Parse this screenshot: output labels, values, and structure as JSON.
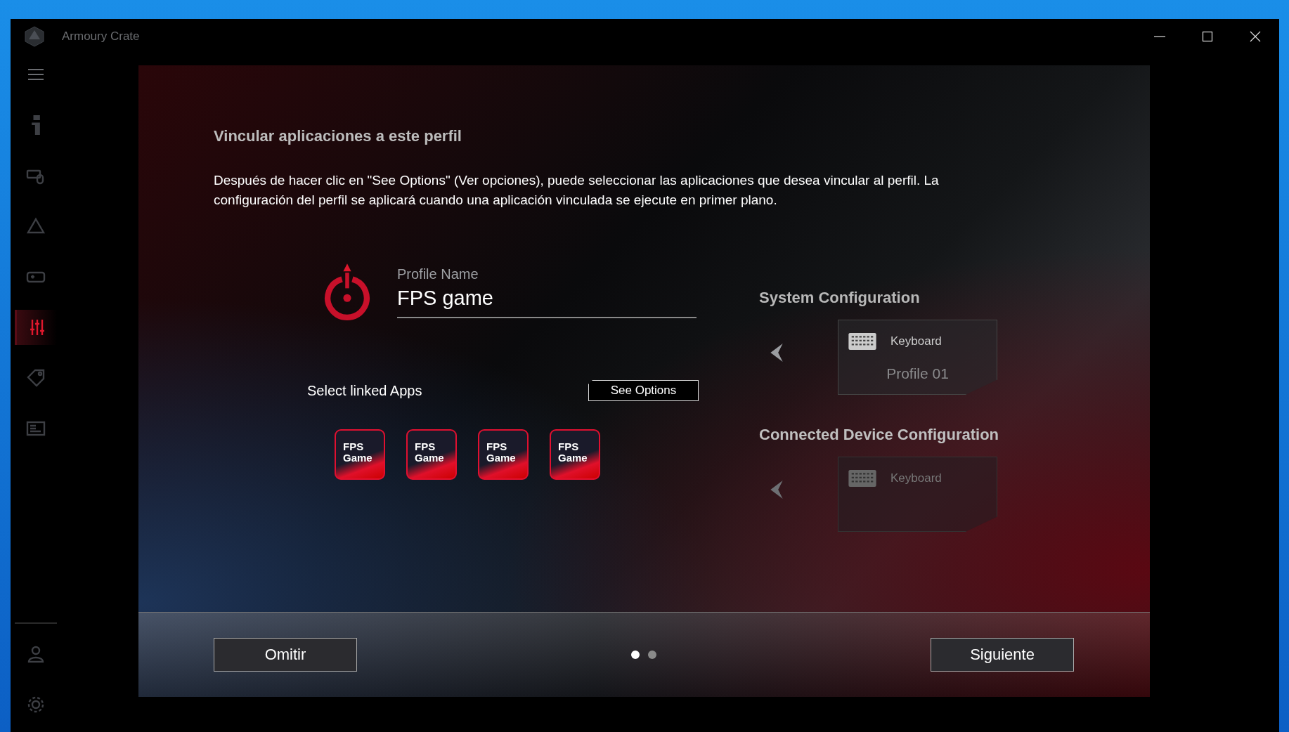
{
  "window": {
    "title": "Armoury Crate"
  },
  "sidebar": {
    "items": [
      {
        "kind": "menu",
        "selected": false
      },
      {
        "kind": "info",
        "selected": false
      },
      {
        "kind": "devices",
        "selected": false
      },
      {
        "kind": "aura",
        "selected": false
      },
      {
        "kind": "gamepad",
        "selected": false
      },
      {
        "kind": "sliders",
        "selected": true
      },
      {
        "kind": "tag",
        "selected": false
      },
      {
        "kind": "news",
        "selected": false
      }
    ],
    "bottom_items": [
      {
        "kind": "user",
        "selected": false
      },
      {
        "kind": "settings",
        "selected": false
      }
    ]
  },
  "dialog": {
    "title": "Vincular aplicaciones a este perfil",
    "description": "Después de hacer clic en \"See Options\" (Ver opciones), puede seleccionar las aplicaciones que desea vincular al perfil. La configuración del perfil se aplicará cuando una aplicación vinculada se ejecute en primer plano.",
    "profile_name": {
      "label": "Profile Name",
      "value": "FPS game"
    },
    "linked_apps": {
      "label": "Select linked Apps",
      "button": "See Options",
      "apps": [
        {
          "label": "FPS Game"
        },
        {
          "label": "FPS Game"
        },
        {
          "label": "FPS Game"
        },
        {
          "label": "FPS Game"
        }
      ]
    },
    "preview": {
      "system_title": "System Configuration",
      "system_card": {
        "label": "Keyboard",
        "value": "Profile 01"
      },
      "connected_title": "Connected Device Configuration",
      "connected_card": {
        "label": "Keyboard"
      }
    },
    "pager": [
      {
        "selected": true
      },
      {
        "selected": false
      }
    ],
    "skip_button": "Omitir",
    "next_button": "Siguiente"
  }
}
